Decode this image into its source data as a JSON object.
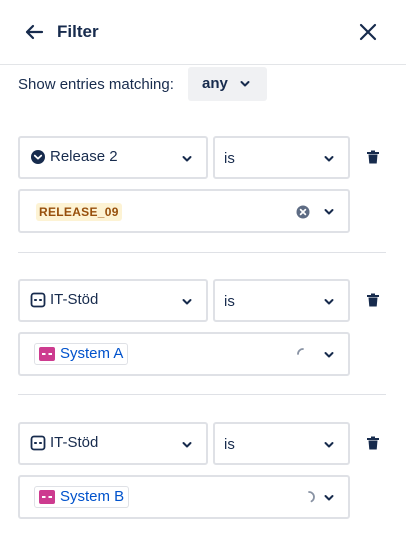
{
  "header": {
    "title": "Filter",
    "back_icon": "arrow-left-icon",
    "close_icon": "close-icon"
  },
  "match": {
    "label": "Show entries matching:",
    "value": "any"
  },
  "colors": {
    "text": "#172b4d",
    "border": "#dfe1e6",
    "link": "#0052cc",
    "chip_icon": "#cd3b8f",
    "lozenge_bg": "#fdf3d4",
    "lozenge_text": "#974f0c"
  },
  "rules": [
    {
      "field_label": "Release 2",
      "field_icon": "release-icon",
      "operator": "is",
      "value_type": "lozenge",
      "value": "RELEASE_09",
      "trailing": "clear"
    },
    {
      "field_label": "IT-Stöd",
      "field_icon": "object-icon",
      "operator": "is",
      "value_type": "chip",
      "value": "System A",
      "trailing": "spinner"
    },
    {
      "field_label": "IT-Stöd",
      "field_icon": "object-icon",
      "operator": "is",
      "value_type": "chip",
      "value": "System B",
      "trailing": "spinner"
    }
  ]
}
